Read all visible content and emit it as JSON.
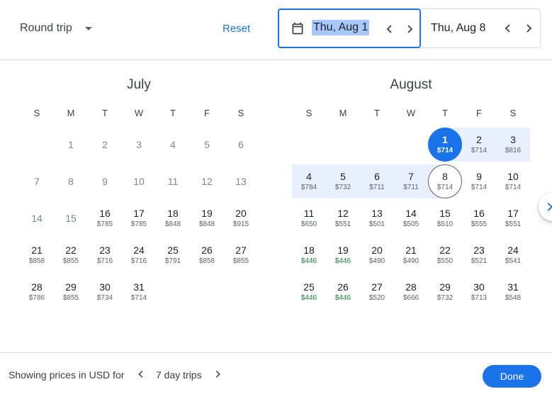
{
  "header": {
    "trip_type": "Round trip",
    "reset_label": "Reset",
    "departure_date": "Thu, Aug 1",
    "return_date": "Thu, Aug 8"
  },
  "weekdays": [
    "S",
    "M",
    "T",
    "W",
    "T",
    "F",
    "S"
  ],
  "months": [
    {
      "name": "July",
      "weeks": [
        [
          null,
          {
            "d": "1",
            "past": true
          },
          {
            "d": "2",
            "past": true
          },
          {
            "d": "3",
            "past": true
          },
          {
            "d": "4",
            "past": true
          },
          {
            "d": "5",
            "past": true
          },
          {
            "d": "6",
            "past": true
          }
        ],
        [
          {
            "d": "7",
            "past": true
          },
          {
            "d": "8",
            "past": true
          },
          {
            "d": "9",
            "past": true
          },
          {
            "d": "10",
            "past": true
          },
          {
            "d": "11",
            "past": true
          },
          {
            "d": "12",
            "past": true
          },
          {
            "d": "13",
            "past": true
          }
        ],
        [
          {
            "d": "14",
            "past": true
          },
          {
            "d": "15",
            "past": true
          },
          {
            "d": "16",
            "p": "$785"
          },
          {
            "d": "17",
            "p": "$785"
          },
          {
            "d": "18",
            "p": "$848"
          },
          {
            "d": "19",
            "p": "$848"
          },
          {
            "d": "20",
            "p": "$915"
          }
        ],
        [
          {
            "d": "21",
            "p": "$858"
          },
          {
            "d": "22",
            "p": "$855"
          },
          {
            "d": "23",
            "p": "$716"
          },
          {
            "d": "24",
            "p": "$716"
          },
          {
            "d": "25",
            "p": "$791"
          },
          {
            "d": "26",
            "p": "$858"
          },
          {
            "d": "27",
            "p": "$855"
          }
        ],
        [
          {
            "d": "28",
            "p": "$786"
          },
          {
            "d": "29",
            "p": "$855"
          },
          {
            "d": "30",
            "p": "$734"
          },
          {
            "d": "31",
            "p": "$714"
          },
          null,
          null,
          null
        ]
      ]
    },
    {
      "name": "August",
      "weeks": [
        [
          null,
          null,
          null,
          null,
          {
            "d": "1",
            "p": "$714",
            "sel": "start"
          },
          {
            "d": "2",
            "p": "$714",
            "range": true
          },
          {
            "d": "3",
            "p": "$816",
            "range": true
          }
        ],
        [
          {
            "d": "4",
            "p": "$784",
            "range": true
          },
          {
            "d": "5",
            "p": "$732",
            "range": true
          },
          {
            "d": "6",
            "p": "$711",
            "range": true
          },
          {
            "d": "7",
            "p": "$711",
            "range": true
          },
          {
            "d": "8",
            "p": "$714",
            "sel": "end"
          },
          {
            "d": "9",
            "p": "$714"
          },
          {
            "d": "10",
            "p": "$714"
          }
        ],
        [
          {
            "d": "11",
            "p": "$650"
          },
          {
            "d": "12",
            "p": "$551"
          },
          {
            "d": "13",
            "p": "$501"
          },
          {
            "d": "14",
            "p": "$505"
          },
          {
            "d": "15",
            "p": "$510"
          },
          {
            "d": "16",
            "p": "$555"
          },
          {
            "d": "17",
            "p": "$551"
          }
        ],
        [
          {
            "d": "18",
            "p": "$446",
            "low": true
          },
          {
            "d": "19",
            "p": "$446",
            "low": true
          },
          {
            "d": "20",
            "p": "$490"
          },
          {
            "d": "21",
            "p": "$490"
          },
          {
            "d": "22",
            "p": "$550"
          },
          {
            "d": "23",
            "p": "$521"
          },
          {
            "d": "24",
            "p": "$541"
          }
        ],
        [
          {
            "d": "25",
            "p": "$446",
            "low": true
          },
          {
            "d": "26",
            "p": "$446",
            "low": true
          },
          {
            "d": "27",
            "p": "$520"
          },
          {
            "d": "28",
            "p": "$666"
          },
          {
            "d": "29",
            "p": "$732"
          },
          {
            "d": "30",
            "p": "$713"
          },
          {
            "d": "31",
            "p": "$548"
          }
        ]
      ]
    }
  ],
  "footer": {
    "currency_note": "Showing prices in USD for",
    "trip_length": "7 day trips",
    "done_label": "Done"
  },
  "colors": {
    "accent": "#1a73e8",
    "range_fill": "#e8f0fe",
    "low_price": "#188038"
  },
  "icons": [
    "calendar-icon",
    "caret-down-icon",
    "chevron-left-icon",
    "chevron-right-icon"
  ]
}
